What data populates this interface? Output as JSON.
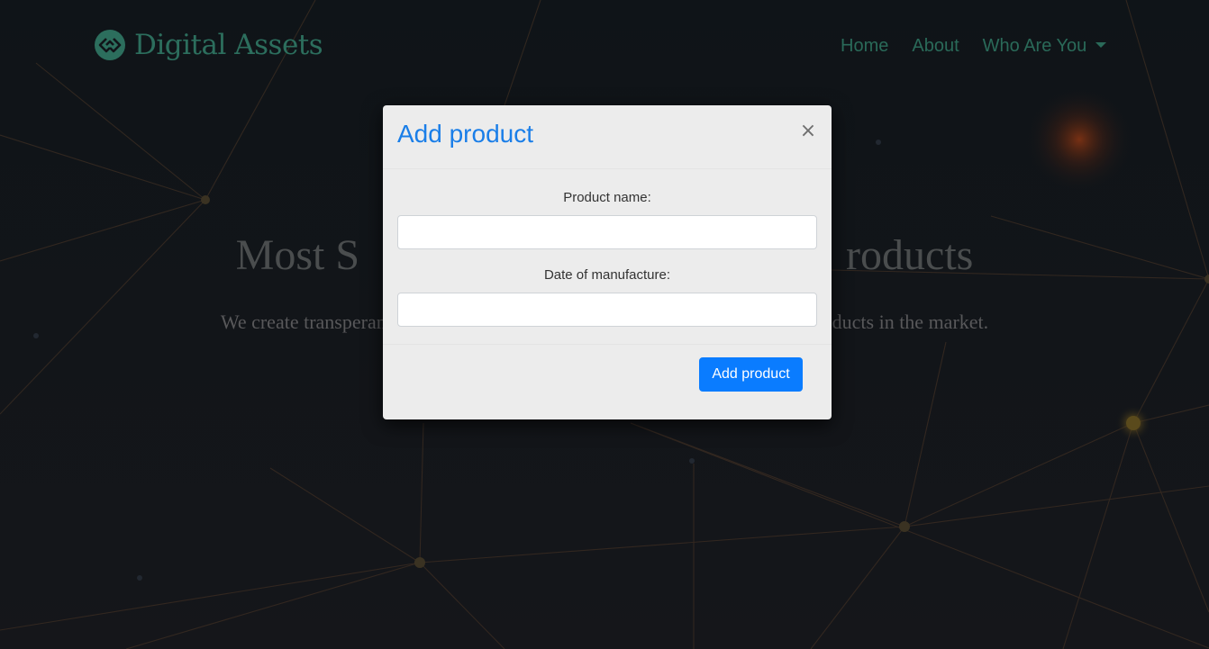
{
  "brand": {
    "name": "Digital Assets",
    "icon": "diamond-link-icon"
  },
  "nav": {
    "items": [
      {
        "label": "Home"
      },
      {
        "label": "About"
      },
      {
        "label": "Who Are You",
        "has_dropdown": true
      }
    ]
  },
  "hero": {
    "title": "Most S                                             roducts",
    "subtitle": "We create transperancy in the a                                                        pirated products in the market."
  },
  "modal": {
    "title": "Add product",
    "close_label": "×",
    "fields": [
      {
        "label": "Product name:",
        "value": ""
      },
      {
        "label": "Date of manufacture:",
        "value": ""
      }
    ],
    "submit_label": "Add product"
  },
  "colors": {
    "accent": "#0a7cff",
    "modal_title": "#1a7ee8",
    "brand": "#2c6e5d",
    "background": "#111419"
  }
}
